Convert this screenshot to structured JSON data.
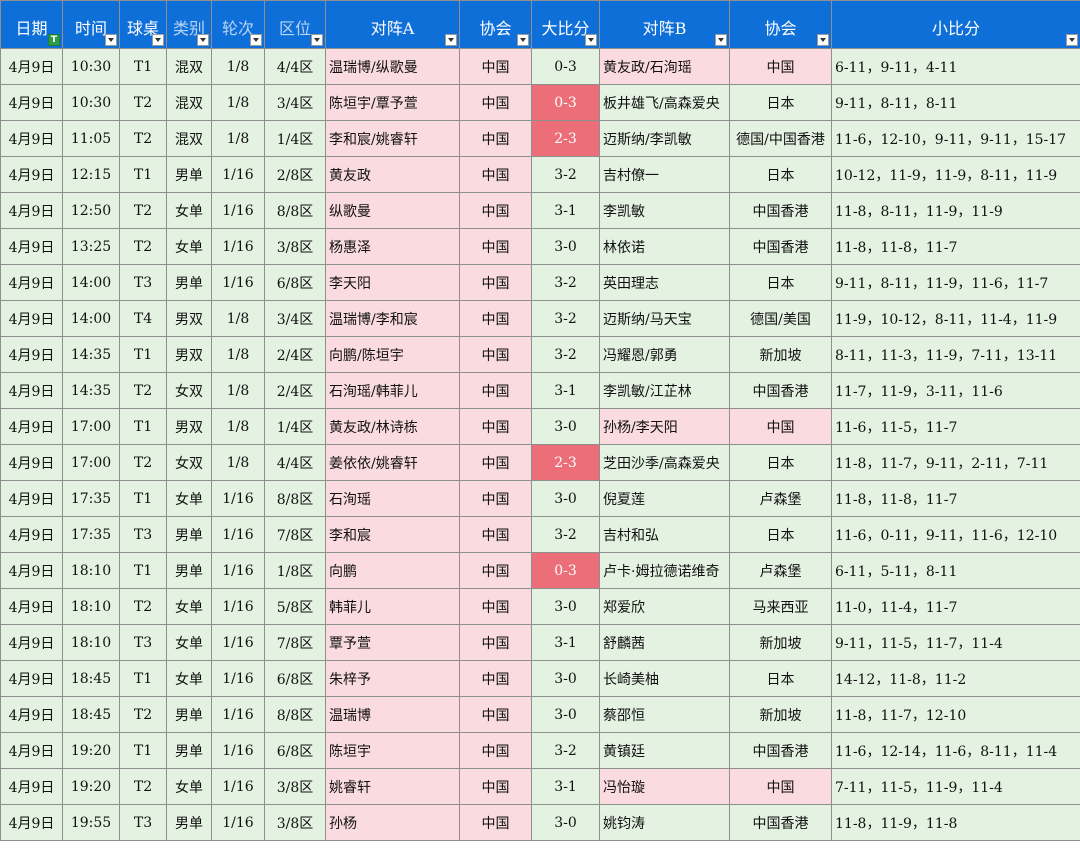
{
  "headers": [
    "日期",
    "时间",
    "球桌",
    "类别",
    "轮次",
    "区位",
    "对阵A",
    "协会",
    "大比分",
    "对阵B",
    "协会",
    "小比分"
  ],
  "rows": [
    [
      "4月9日",
      "10:30",
      "T1",
      "混双",
      "1/8",
      "4/4区",
      "温瑞博/纵歌曼",
      "中国",
      "0-3",
      "黄友政/石洵瑶",
      "中国",
      "6-11，9-11，4-11"
    ],
    [
      "4月9日",
      "10:30",
      "T2",
      "混双",
      "1/8",
      "3/4区",
      "陈垣宇/覃予萱",
      "中国",
      "0-3",
      "板井雄飞/高森爱央",
      "日本",
      "9-11，8-11，8-11"
    ],
    [
      "4月9日",
      "11:05",
      "T2",
      "混双",
      "1/8",
      "1/4区",
      "李和宸/姚睿轩",
      "中国",
      "2-3",
      "迈斯纳/李凯敏",
      "德国/中国香港",
      "11-6，12-10，9-11，9-11，15-17"
    ],
    [
      "4月9日",
      "12:15",
      "T1",
      "男单",
      "1/16",
      "2/8区",
      "黄友政",
      "中国",
      "3-2",
      "吉村僚一",
      "日本",
      "10-12，11-9，11-9，8-11，11-9"
    ],
    [
      "4月9日",
      "12:50",
      "T2",
      "女单",
      "1/16",
      "8/8区",
      "纵歌曼",
      "中国",
      "3-1",
      "李凯敏",
      "中国香港",
      "11-8，8-11，11-9，11-9"
    ],
    [
      "4月9日",
      "13:25",
      "T2",
      "女单",
      "1/16",
      "3/8区",
      "杨惠泽",
      "中国",
      "3-0",
      "林依诺",
      "中国香港",
      "11-8，11-8，11-7"
    ],
    [
      "4月9日",
      "14:00",
      "T3",
      "男单",
      "1/16",
      "6/8区",
      "李天阳",
      "中国",
      "3-2",
      "英田理志",
      "日本",
      "9-11，8-11，11-9，11-6，11-7"
    ],
    [
      "4月9日",
      "14:00",
      "T4",
      "男双",
      "1/8",
      "3/4区",
      "温瑞博/李和宸",
      "中国",
      "3-2",
      "迈斯纳/马天宝",
      "德国/美国",
      "11-9，10-12，8-11，11-4，11-9"
    ],
    [
      "4月9日",
      "14:35",
      "T1",
      "男双",
      "1/8",
      "2/4区",
      "向鹏/陈垣宇",
      "中国",
      "3-2",
      "冯耀恩/郭勇",
      "新加坡",
      "8-11，11-3，11-9，7-11，13-11"
    ],
    [
      "4月9日",
      "14:35",
      "T2",
      "女双",
      "1/8",
      "2/4区",
      "石洵瑶/韩菲儿",
      "中国",
      "3-1",
      "李凯敏/江芷林",
      "中国香港",
      "11-7，11-9，3-11，11-6"
    ],
    [
      "4月9日",
      "17:00",
      "T1",
      "男双",
      "1/8",
      "1/4区",
      "黄友政/林诗栋",
      "中国",
      "3-0",
      "孙杨/李天阳",
      "中国",
      "11-6，11-5，11-7"
    ],
    [
      "4月9日",
      "17:00",
      "T2",
      "女双",
      "1/8",
      "4/4区",
      "姜依依/姚睿轩",
      "中国",
      "2-3",
      "芝田沙季/高森爱央",
      "日本",
      "11-8，11-7，9-11，2-11，7-11"
    ],
    [
      "4月9日",
      "17:35",
      "T1",
      "女单",
      "1/16",
      "8/8区",
      "石洵瑶",
      "中国",
      "3-0",
      "倪夏莲",
      "卢森堡",
      "11-8，11-8，11-7"
    ],
    [
      "4月9日",
      "17:35",
      "T3",
      "男单",
      "1/16",
      "7/8区",
      "李和宸",
      "中国",
      "3-2",
      "吉村和弘",
      "日本",
      "11-6，0-11，9-11，11-6，12-10"
    ],
    [
      "4月9日",
      "18:10",
      "T1",
      "男单",
      "1/16",
      "1/8区",
      "向鹏",
      "中国",
      "0-3",
      "卢卡·姆拉德诺维奇",
      "卢森堡",
      "6-11，5-11，8-11"
    ],
    [
      "4月9日",
      "18:10",
      "T2",
      "女单",
      "1/16",
      "5/8区",
      "韩菲儿",
      "中国",
      "3-0",
      "郑爱欣",
      "马来西亚",
      "11-0，11-4，11-7"
    ],
    [
      "4月9日",
      "18:10",
      "T3",
      "女单",
      "1/16",
      "7/8区",
      "覃予萱",
      "中国",
      "3-1",
      "舒麟茜",
      "新加坡",
      "9-11，11-5，11-7，11-4"
    ],
    [
      "4月9日",
      "18:45",
      "T1",
      "女单",
      "1/16",
      "6/8区",
      "朱梓予",
      "中国",
      "3-0",
      "长崎美柚",
      "日本",
      "14-12，11-8，11-2"
    ],
    [
      "4月9日",
      "18:45",
      "T2",
      "男单",
      "1/16",
      "8/8区",
      "温瑞博",
      "中国",
      "3-0",
      "蔡邵恒",
      "新加坡",
      "11-8，11-7，12-10"
    ],
    [
      "4月9日",
      "19:20",
      "T1",
      "男单",
      "1/16",
      "6/8区",
      "陈垣宇",
      "中国",
      "3-2",
      "黄镇廷",
      "中国香港",
      "11-6，12-14，11-6，8-11，11-4"
    ],
    [
      "4月9日",
      "19:20",
      "T2",
      "女单",
      "1/16",
      "3/8区",
      "姚睿轩",
      "中国",
      "3-1",
      "冯怡璇",
      "中国",
      "7-11，11-5，11-9，11-4"
    ],
    [
      "4月9日",
      "19:55",
      "T3",
      "男单",
      "1/16",
      "3/8区",
      "孙杨",
      "中国",
      "3-0",
      "姚钧涛",
      "中国香港",
      "11-8，11-9，11-8"
    ]
  ],
  "highlight": {
    "pink_b_rows": [
      0,
      10,
      20
    ],
    "loss_score_rows": [
      1,
      2,
      11,
      14
    ]
  },
  "colors": {
    "header_bg": "#0f6fd8",
    "cell_green": "#e3f2e1",
    "cell_pink": "#fadbe0",
    "loss_red": "#eb6e79"
  }
}
